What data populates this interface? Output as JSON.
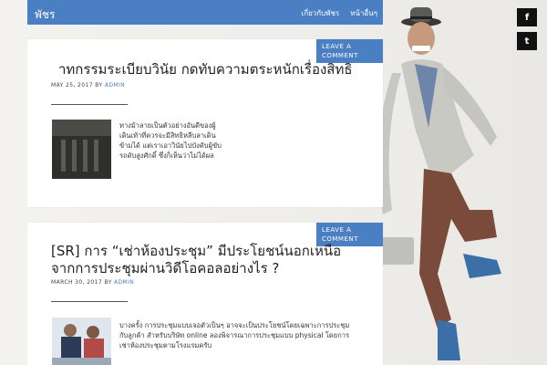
{
  "header": {
    "brand": "พัชร",
    "nav": [
      "เกี่ยวกับพัชร",
      "หน้าอื่นๆ"
    ]
  },
  "social": {
    "facebook": "f",
    "twitter": "t"
  },
  "posts": [
    {
      "comment_label": "LEAVE A COMMENT",
      "title": "าทกรรมระเบียบวินัย กดทับความตระหนักเรื่องสิทธิ",
      "date": "MAY 25, 2017",
      "by": "BY",
      "author": "ADMIN",
      "excerpt": "ทางม้าลายเป็นตัวอย่างอันดีของผู้เดินเท้าที่ควรจะมีสิทธิหลีบลาเดินข้ามได้ แต่เราเอาวินัยไปบังคับผู้ขับรถดับสูงศักดิ์ ซึ่งก็เห็นว่าไม่ได้ผล"
    },
    {
      "comment_label": "LEAVE A COMMENT",
      "title": "[SR] การ “เช่าห้องประชุม” มีประโยชน์นอกเหนือจากการประชุมผ่านวิดีโอคอลอย่างไร ?",
      "date": "MARCH 30, 2017",
      "by": "BY",
      "author": "ADMIN",
      "excerpt": "บางครั้ง การประชุมแบบเจอตัวเป็นๆ อาจจะเป็นประโยชน์โดยเฉพาะการประชุมกับลูกค้า สำหรับบริษัท online ลองพิจารณาการประชุมแบบ physical โดยการเช่าห้องประชุมตามโรงแรมครับ"
    }
  ],
  "colors": {
    "accent": "#4a7fc4"
  }
}
